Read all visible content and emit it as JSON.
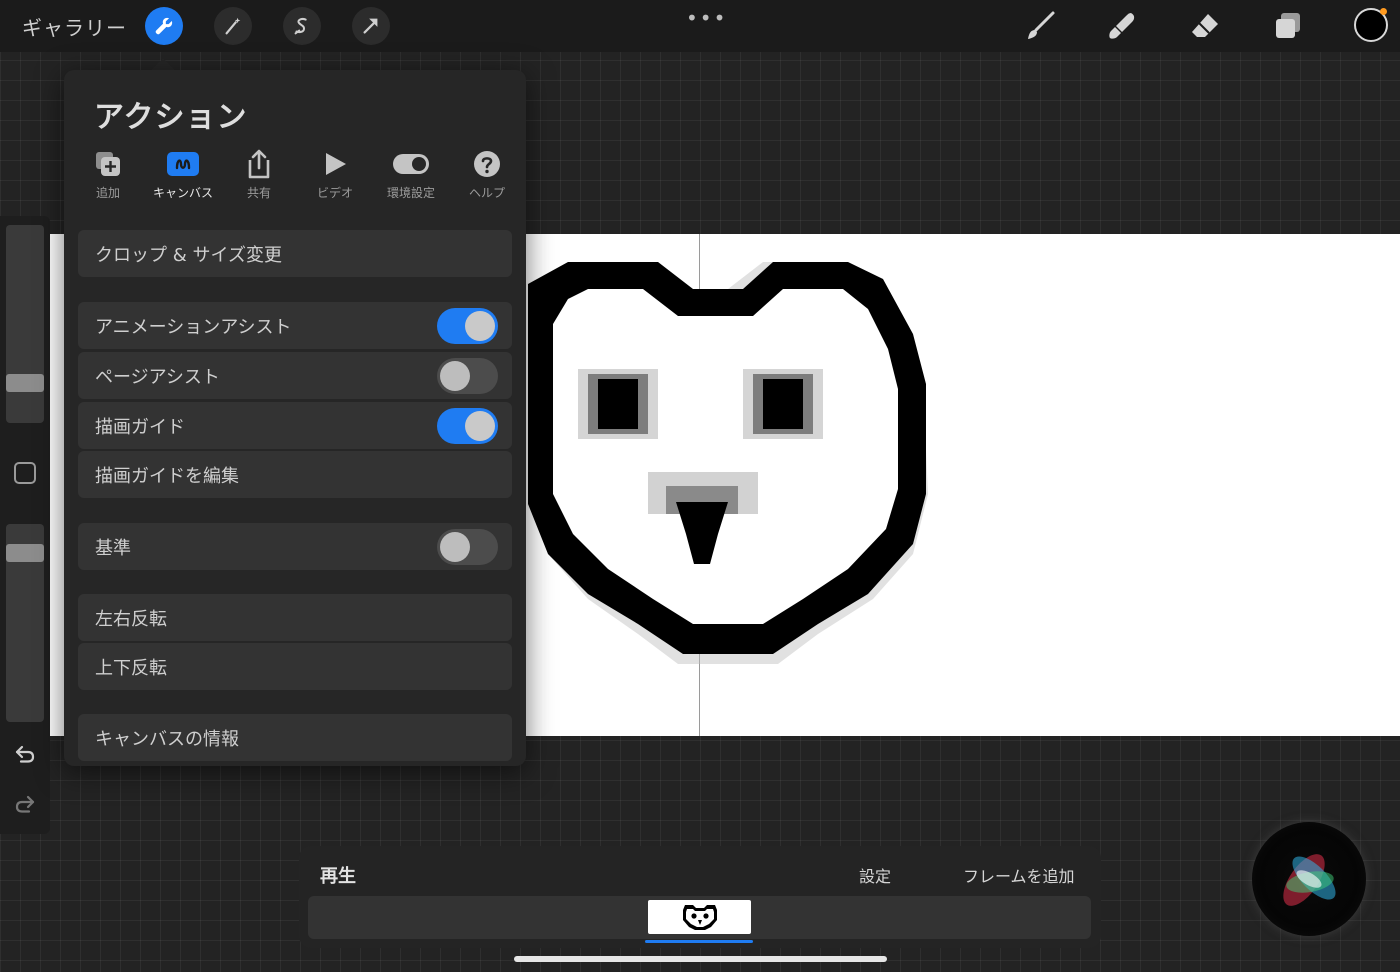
{
  "topbar": {
    "gallery_label": "ギャラリー",
    "more_label": "•••",
    "left_tools": [
      "wrench-icon",
      "magic-wand-icon",
      "selection-icon",
      "transform-arrow-icon"
    ],
    "right_tools": [
      "brush-icon",
      "smudge-icon",
      "eraser-icon",
      "layers-icon"
    ],
    "current_color": "#000000"
  },
  "actions_panel": {
    "title": "アクション",
    "tabs": [
      {
        "label": "追加",
        "icon": "add-icon"
      },
      {
        "label": "キャンバス",
        "icon": "canvas-icon",
        "active": true
      },
      {
        "label": "共有",
        "icon": "share-icon"
      },
      {
        "label": "ビデオ",
        "icon": "play-icon"
      },
      {
        "label": "環境設定",
        "icon": "toggle-prefs-icon"
      },
      {
        "label": "ヘルプ",
        "icon": "help-icon"
      }
    ],
    "rows": {
      "crop_resize": "クロップ & サイズ変更",
      "animation_assist": {
        "label": "アニメーションアシスト",
        "on": true
      },
      "page_assist": {
        "label": "ページアシスト",
        "on": false
      },
      "drawing_guide": {
        "label": "描画ガイド",
        "on": true
      },
      "edit_drawing_guide": "描画ガイドを編集",
      "reference": {
        "label": "基準",
        "on": false
      },
      "flip_horizontal": "左右反転",
      "flip_vertical": "上下反転",
      "canvas_info": "キャンバスの情報"
    }
  },
  "sidebar": {
    "brush_size": 0.21,
    "opacity": 0.85
  },
  "animation_bar": {
    "play_label": "再生",
    "settings_label": "設定",
    "add_frame_label": "フレームを追加",
    "frames": 1,
    "selected_frame": 1
  },
  "colors": {
    "accent": "#1f7cf2",
    "background": "#232323",
    "panel": "#262626",
    "row": "#333333"
  }
}
